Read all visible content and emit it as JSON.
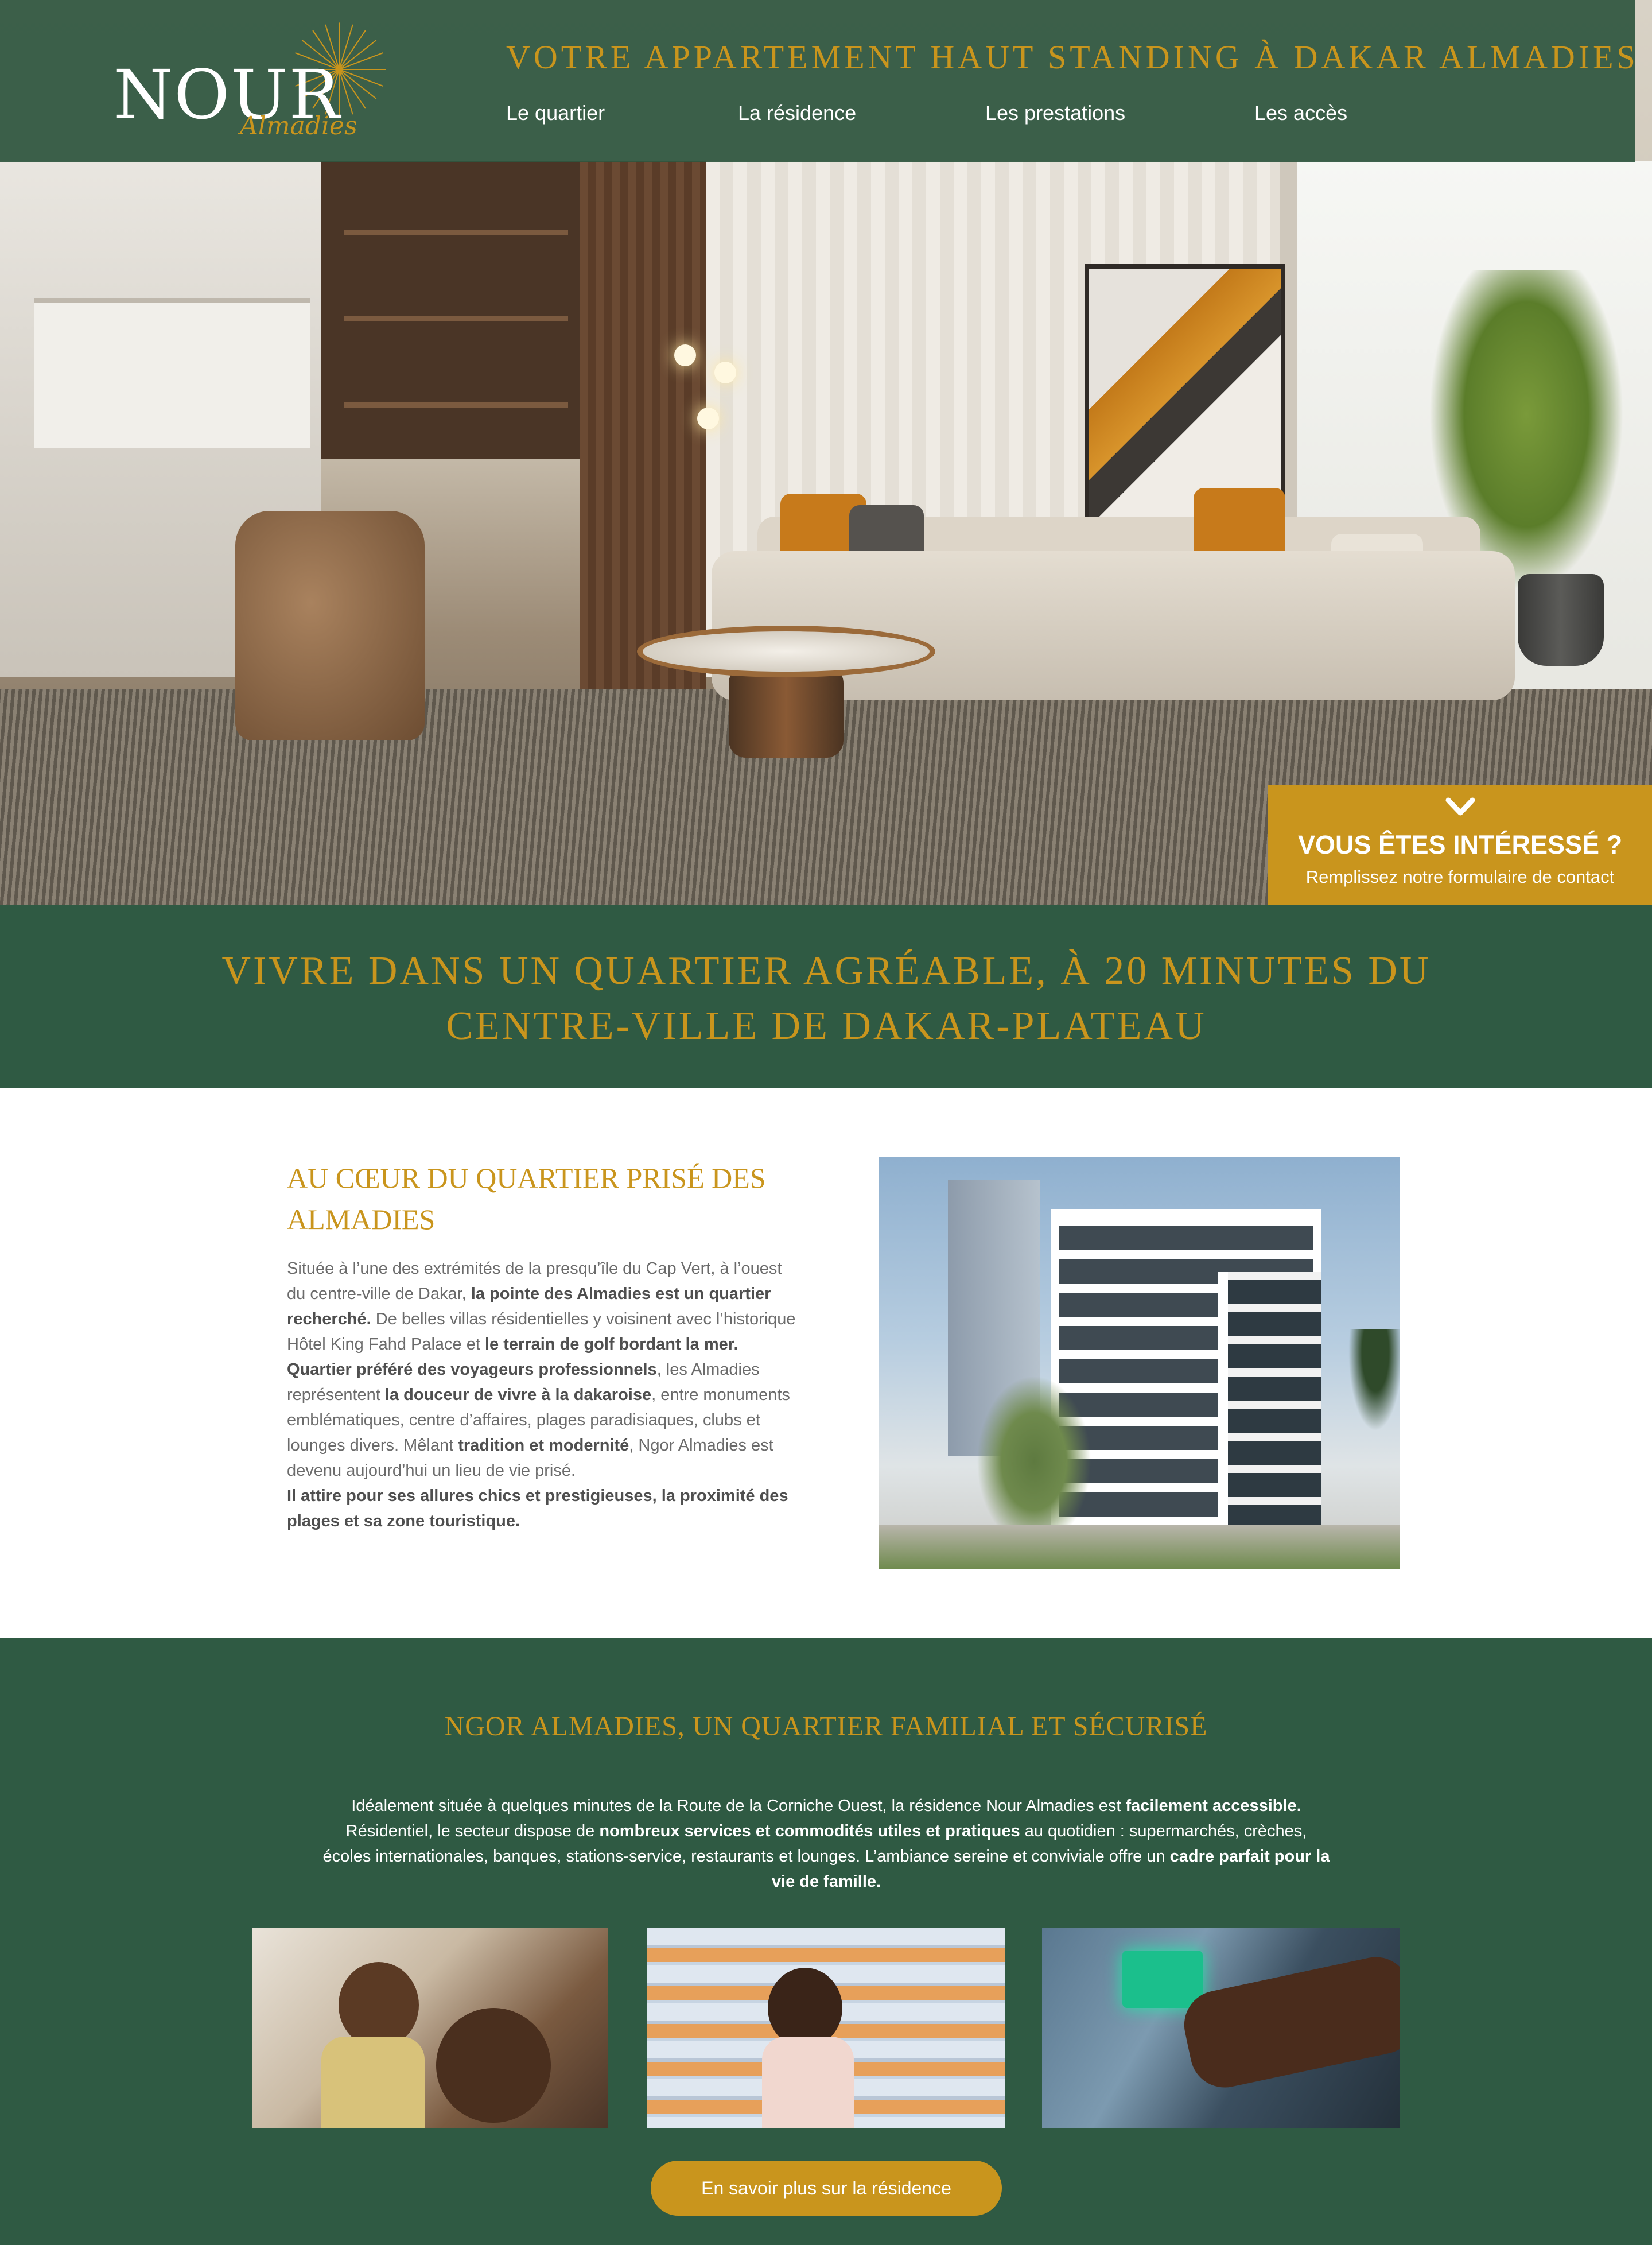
{
  "header": {
    "logo": {
      "word": "NOUR",
      "sub": "Almadies"
    },
    "tagline": "VOTRE APPARTEMENT HAUT STANDING À DAKAR ALMADIES",
    "nav": [
      {
        "label": "Le quartier"
      },
      {
        "label": "La résidence"
      },
      {
        "label": "Les prestations"
      },
      {
        "label": "Les accès"
      }
    ]
  },
  "cta": {
    "icon": "chevron-down-icon",
    "title": "VOUS ÊTES INTÉRESSÉ ?",
    "subtitle": "Remplissez notre formulaire de contact"
  },
  "banner": {
    "line1": "VIVRE DANS UN QUARTIER AGRÉABLE, À 20 MINUTES DU",
    "line2": "CENTRE-VILLE DE DAKAR-PLATEAU"
  },
  "section1": {
    "title": "AU CŒUR DU QUARTIER PRISÉ DES ALMADIES",
    "p1": [
      {
        "t": "Située à l’une des extrémités de la presqu’île du Cap Vert, à l’ouest du centre-ville de Dakar, ",
        "b": false
      },
      {
        "t": "la pointe des Almadies est un quartier recherché.",
        "b": true
      },
      {
        "t": " De belles villas résidentielles y voisinent avec l’historique Hôtel King Fahd Palace et ",
        "b": false
      },
      {
        "t": "le terrain de golf bordant la mer.",
        "b": true
      }
    ],
    "p2": [
      {
        "t": "Quartier préféré des voyageurs professionnels",
        "b": true
      },
      {
        "t": ", les Almadies représentent ",
        "b": false
      },
      {
        "t": "la douceur de vivre à la dakaroise",
        "b": true
      },
      {
        "t": ", entre monuments emblématiques, centre d’affaires, plages paradisiaques, clubs et lounges divers. Mêlant ",
        "b": false
      },
      {
        "t": "tradition et modernité",
        "b": true
      },
      {
        "t": ", Ngor Almadies est devenu aujourd’hui un lieu de vie prisé.",
        "b": false
      }
    ],
    "p3": [
      {
        "t": "Il attire pour ses allures chics et prestigieuses, la proximité des plages et sa zone touristique.",
        "b": true
      }
    ]
  },
  "section2": {
    "title": "NGOR ALMADIES, UN QUARTIER FAMILIAL ET SÉCURISÉ",
    "text": [
      {
        "t": "Idéalement située à quelques minutes de la Route de la Corniche Ouest, la résidence Nour Almadies est ",
        "b": false
      },
      {
        "t": "facilement accessible.",
        "b": true
      },
      {
        "t": " Résidentiel, le secteur dispose de ",
        "b": false
      },
      {
        "t": "nombreux services et commodités utiles et pratiques",
        "b": true
      },
      {
        "t": " au quotidien : supermarchés, crèches, écoles internationales, banques, stations-service, restaurants et lounges. L’ambiance sereine et conviviale offre un ",
        "b": false
      },
      {
        "t": "cadre parfait pour la vie de famille.",
        "b": true
      }
    ],
    "button": "En savoir plus sur la résidence"
  },
  "colors": {
    "green": "#2f5a43",
    "gold": "#c9951d",
    "white": "#ffffff"
  }
}
